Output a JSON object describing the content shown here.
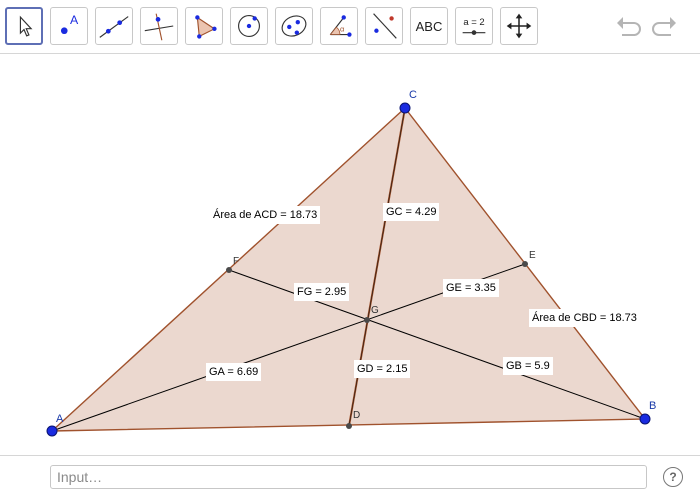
{
  "toolbar": {
    "tools": [
      {
        "name": "move",
        "active": true
      },
      {
        "name": "point",
        "glyph": "A"
      },
      {
        "name": "line"
      },
      {
        "name": "perpendicular-line"
      },
      {
        "name": "polygon"
      },
      {
        "name": "circle"
      },
      {
        "name": "ellipse"
      },
      {
        "name": "angle"
      },
      {
        "name": "reflect"
      },
      {
        "name": "text",
        "glyph": "ABC"
      },
      {
        "name": "slider",
        "glyph": "a = 2"
      },
      {
        "name": "move-graphics-view"
      }
    ],
    "undo": "undo-icon",
    "redo": "redo-icon"
  },
  "canvas": {
    "colors": {
      "fill": "#ebd8cf",
      "triangle_edge": "#a0522d",
      "point": "#1a2be0",
      "segment": "#000000"
    },
    "points": {
      "A": "A",
      "B": "B",
      "C": "C",
      "D": "D",
      "E": "E",
      "F": "F",
      "G": "G"
    },
    "labels": {
      "area_acd": "Área de  ACD = 18.73",
      "area_cbd": "Área de  CBD = 18.73",
      "gc": "GC = 4.29",
      "fg": "FG = 2.95",
      "ge": "GE = 3.35",
      "ga": "GA = 6.69",
      "gd": "GD = 2.15",
      "gb": "GB = 5.9"
    }
  },
  "footer": {
    "input_placeholder": "Input…",
    "help_glyph": "?"
  }
}
